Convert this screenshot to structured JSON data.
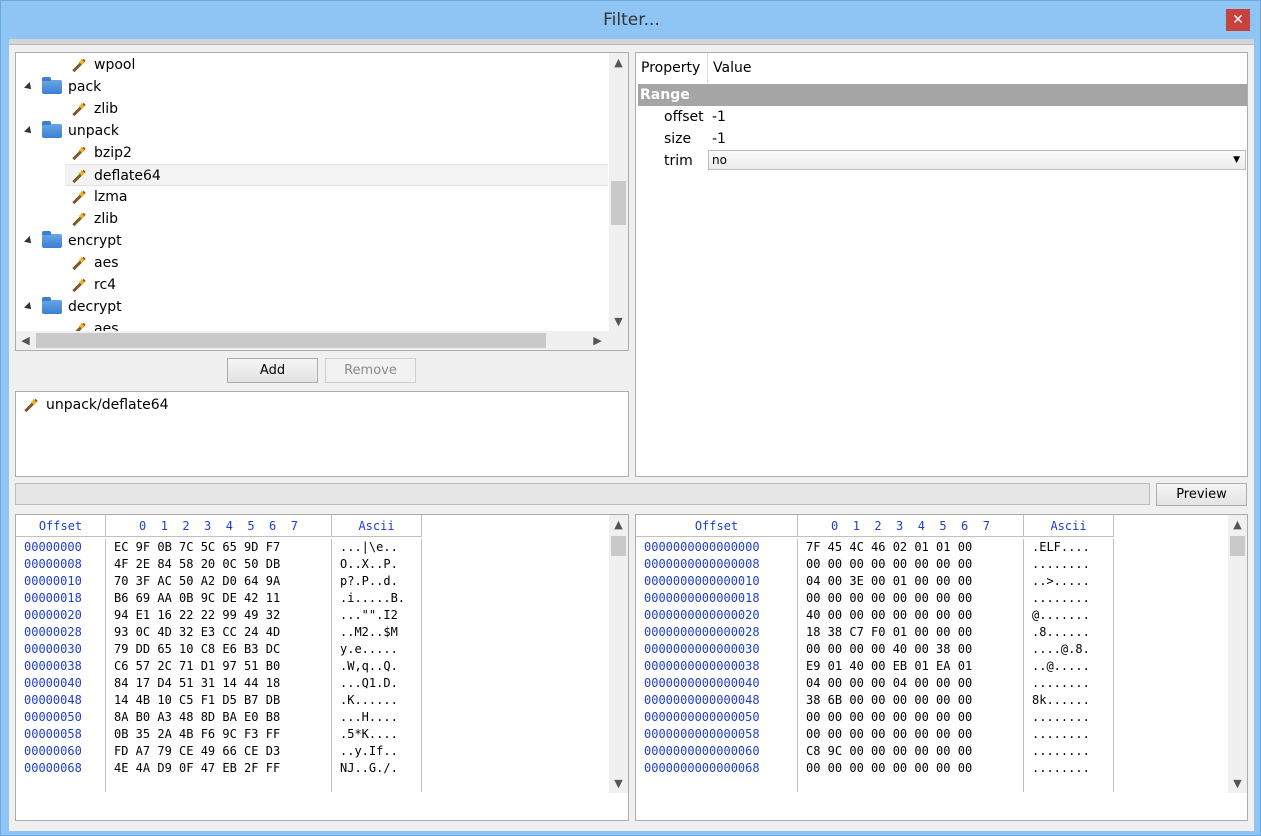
{
  "window": {
    "title": "Filter...",
    "close_label": "✕"
  },
  "tree": {
    "items": [
      {
        "label": "wpool",
        "kind": "filter",
        "level": 1
      },
      {
        "label": "pack",
        "kind": "folder",
        "level": 0
      },
      {
        "label": "zlib",
        "kind": "filter",
        "level": 1
      },
      {
        "label": "unpack",
        "kind": "folder",
        "level": 0
      },
      {
        "label": "bzip2",
        "kind": "filter",
        "level": 1
      },
      {
        "label": "deflate64",
        "kind": "filter",
        "level": 1,
        "selected": true
      },
      {
        "label": "lzma",
        "kind": "filter",
        "level": 1
      },
      {
        "label": "zlib",
        "kind": "filter",
        "level": 1
      },
      {
        "label": "encrypt",
        "kind": "folder",
        "level": 0
      },
      {
        "label": "aes",
        "kind": "filter",
        "level": 1
      },
      {
        "label": "rc4",
        "kind": "filter",
        "level": 1
      },
      {
        "label": "decrypt",
        "kind": "folder",
        "level": 0
      },
      {
        "label": "aes",
        "kind": "filter",
        "level": 1
      }
    ],
    "icons": {
      "folder": "folder-icon",
      "filter": "magic-wand-icon"
    }
  },
  "buttons": {
    "add": "Add",
    "remove": "Remove",
    "preview": "Preview"
  },
  "selected_filters": [
    {
      "label": "unpack/deflate64",
      "icon": "magic-wand-icon"
    }
  ],
  "properties": {
    "headers": {
      "property": "Property",
      "value": "Value"
    },
    "group": "Range",
    "rows": [
      {
        "name": "offset",
        "value": "-1"
      },
      {
        "name": "size",
        "value": "-1"
      },
      {
        "name": "trim",
        "value": "no",
        "type": "dropdown"
      }
    ]
  },
  "hex_left": {
    "headers": {
      "offset": "Offset",
      "bytes": "0  1  2  3  4  5  6  7",
      "ascii": "Ascii"
    },
    "offsets": [
      "00000000",
      "00000008",
      "00000010",
      "00000018",
      "00000020",
      "00000028",
      "00000030",
      "00000038",
      "00000040",
      "00000048",
      "00000050",
      "00000058",
      "00000060",
      "00000068"
    ],
    "bytes": [
      "EC 9F 0B 7C 5C 65 9D F7",
      "4F 2E 84 58 20 0C 50 DB",
      "70 3F AC 50 A2 D0 64 9A",
      "B6 69 AA 0B 9C DE 42 11",
      "94 E1 16 22 22 99 49 32",
      "93 0C 4D 32 E3 CC 24 4D",
      "79 DD 65 10 C8 E6 B3 DC",
      "C6 57 2C 71 D1 97 51 B0",
      "84 17 D4 51 31 14 44 18",
      "14 4B 10 C5 F1 D5 B7 DB",
      "8A B0 A3 48 8D BA E0 B8",
      "0B 35 2A 4B F6 9C F3 FF",
      "FD A7 79 CE 49 66 CE D3",
      "4E 4A D9 0F 47 EB 2F FF"
    ],
    "ascii": [
      "...|\\e..",
      "O..X..P.",
      "p?.P..d.",
      ".i.....B.",
      "...\"\".I2",
      "..M2..$M",
      "y.e.....",
      ".W,q..Q.",
      "...Q1.D.",
      ".K......",
      "...H....",
      ".5*K....",
      "..y.If..",
      "NJ..G./."
    ]
  },
  "hex_right": {
    "headers": {
      "offset": "Offset",
      "bytes": "0  1  2  3  4  5  6  7",
      "ascii": "Ascii"
    },
    "offsets": [
      "0000000000000000",
      "0000000000000008",
      "0000000000000010",
      "0000000000000018",
      "0000000000000020",
      "0000000000000028",
      "0000000000000030",
      "0000000000000038",
      "0000000000000040",
      "0000000000000048",
      "0000000000000050",
      "0000000000000058",
      "0000000000000060",
      "0000000000000068"
    ],
    "bytes": [
      "7F 45 4C 46 02 01 01 00",
      "00 00 00 00 00 00 00 00",
      "04 00 3E 00 01 00 00 00",
      "00 00 00 00 00 00 00 00",
      "40 00 00 00 00 00 00 00",
      "18 38 C7 F0 01 00 00 00",
      "00 00 00 00 40 00 38 00",
      "E9 01 40 00 EB 01 EA 01",
      "04 00 00 00 04 00 00 00",
      "38 6B 00 00 00 00 00 00",
      "00 00 00 00 00 00 00 00",
      "00 00 00 00 00 00 00 00",
      "C8 9C 00 00 00 00 00 00",
      "00 00 00 00 00 00 00 00"
    ],
    "ascii": [
      ".ELF....",
      "........",
      "..>.....",
      "........",
      "@.......",
      ".8......",
      "....@.8.",
      "..@.....",
      "........",
      "8k......",
      "........",
      "........",
      "........",
      "........"
    ]
  }
}
